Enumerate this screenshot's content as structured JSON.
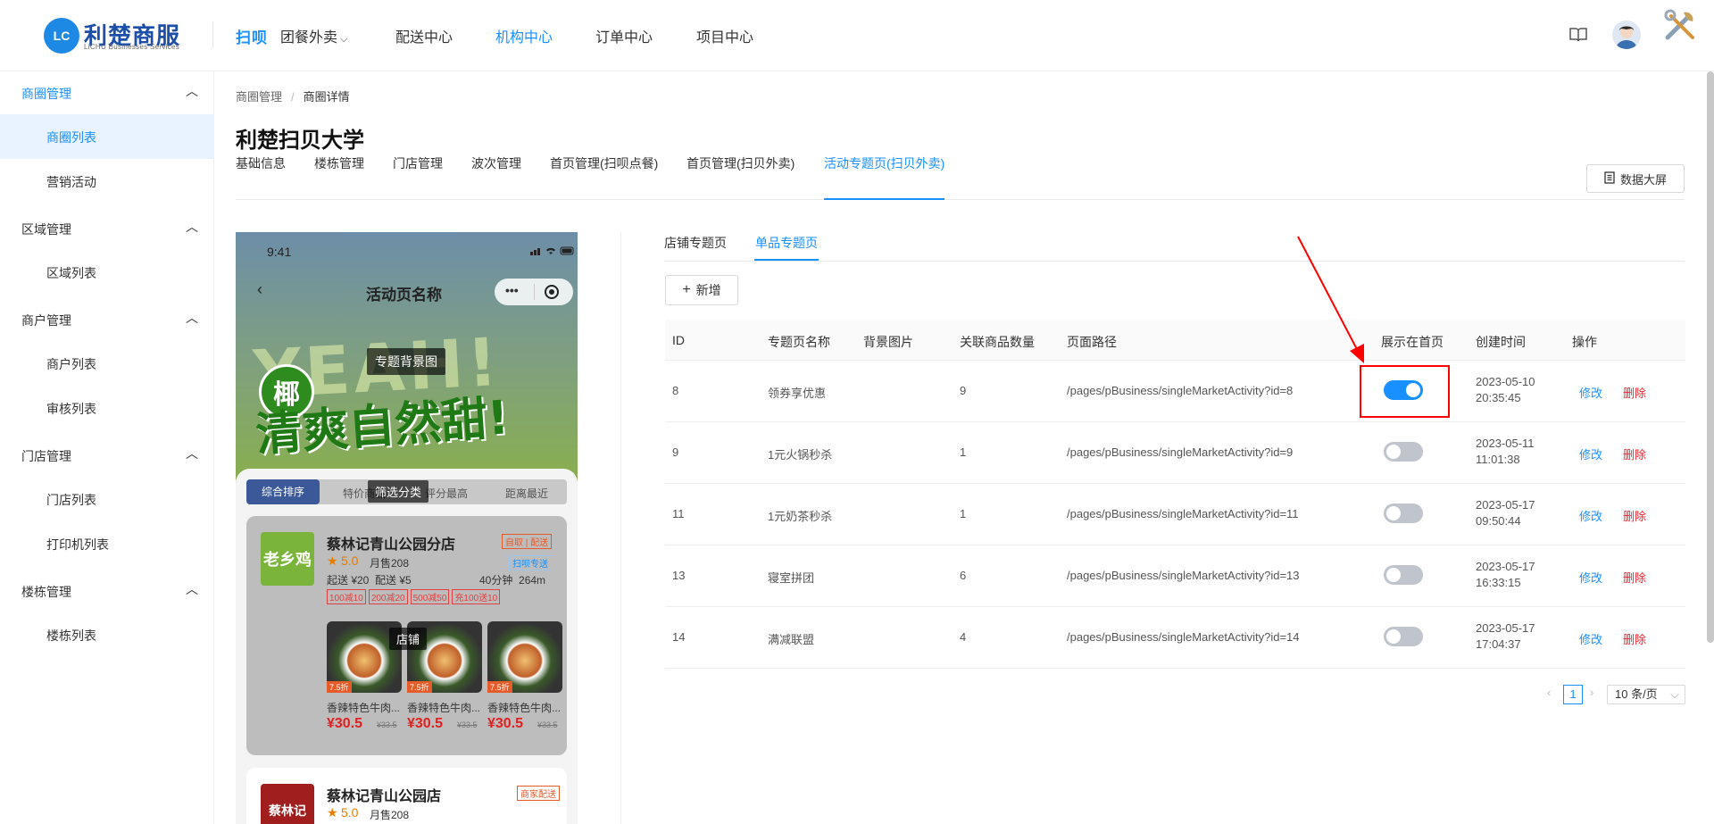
{
  "header": {
    "logo_badge": "LC",
    "logo_title": "利楚商服",
    "logo_subtitle": "LiCHU Businesses Services",
    "brand": "扫呗",
    "nav": [
      "团餐外卖",
      "配送中心",
      "机构中心",
      "订单中心",
      "项目中心"
    ],
    "active_nav": "机构中心",
    "icons": [
      "book-icon",
      "avatar",
      "tools-icon"
    ]
  },
  "sidebar": {
    "groups": [
      {
        "label": "商圈管理",
        "items": [
          "商圈列表",
          "营销活动"
        ]
      },
      {
        "label": "区域管理",
        "items": [
          "区域列表"
        ]
      },
      {
        "label": "商户管理",
        "items": [
          "商户列表",
          "审核列表"
        ]
      },
      {
        "label": "门店管理",
        "items": [
          "门店列表",
          "打印机列表"
        ]
      },
      {
        "label": "楼栋管理",
        "items": [
          "楼栋列表"
        ]
      }
    ],
    "active_item": "商圈列表"
  },
  "breadcrumb": [
    "商圈管理",
    "商圈详情"
  ],
  "page_title": "利楚扫贝大学",
  "tabs": [
    "基础信息",
    "楼栋管理",
    "门店管理",
    "波次管理",
    "首页管理(扫呗点餐)",
    "首页管理(扫贝外卖)",
    "活动专题页(扫贝外卖)"
  ],
  "active_tab": "活动专题页(扫贝外卖)",
  "data_screen_button": "数据大屏",
  "phone": {
    "time": "9:41",
    "title": "活动页名称",
    "bg_label": "专题背景图",
    "banner_text": "YEAH!",
    "slogan": "清爽自然甜!",
    "badge": "椰",
    "sort_tabs": [
      "综合排序",
      "特价商品",
      "评分最高",
      "距离最近"
    ],
    "filter_label": "筛选分类",
    "shop_label": "店铺",
    "store1": {
      "name": "蔡林记青山公园分店",
      "logo": "老乡鸡",
      "tags": "自取 | 配送",
      "rating": "5.0",
      "sales": "月售208",
      "fee": "起送 ¥20  配送 ¥5",
      "eta": "40分钟  264m",
      "express": "扫呗专送",
      "promos": [
        "100减10",
        "200减20",
        "500减50",
        "充100送10"
      ],
      "products": [
        {
          "name": "香辣特色牛肉...",
          "price": "¥30.5",
          "orig": "¥33.5",
          "discount": "7.5折"
        },
        {
          "name": "香辣特色牛肉...",
          "price": "¥30.5",
          "orig": "¥33.5",
          "discount": "7.5折"
        },
        {
          "name": "香辣特色牛肉...",
          "price": "¥30.5",
          "orig": "¥33.5",
          "discount": "7.5折"
        }
      ]
    },
    "store2": {
      "name": "蔡林记青山公园店",
      "logo": "蔡林记",
      "tags": "商家配送",
      "rating": "5.0",
      "sales": "月售208"
    }
  },
  "subtabs": [
    "店铺专题页",
    "单品专题页"
  ],
  "active_subtab": "单品专题页",
  "add_button": "新增",
  "table": {
    "columns": [
      "ID",
      "专题页名称",
      "背景图片",
      "关联商品数量",
      "页面路径",
      "展示在首页",
      "创建时间",
      "操作"
    ],
    "rows": [
      {
        "id": "8",
        "name": "领券享优惠",
        "count": "9",
        "path": "/pages/pBusiness/singleMarketActivity?id=8",
        "show": true,
        "date": "2023-05-10",
        "time": "20:35:45"
      },
      {
        "id": "9",
        "name": "1元火锅秒杀",
        "count": "1",
        "path": "/pages/pBusiness/singleMarketActivity?id=9",
        "show": false,
        "date": "2023-05-11",
        "time": "11:01:38"
      },
      {
        "id": "11",
        "name": "1元奶茶秒杀",
        "count": "1",
        "path": "/pages/pBusiness/singleMarketActivity?id=11",
        "show": false,
        "date": "2023-05-17",
        "time": "09:50:44"
      },
      {
        "id": "13",
        "name": "寝室拼团",
        "count": "6",
        "path": "/pages/pBusiness/singleMarketActivity?id=13",
        "show": false,
        "date": "2023-05-17",
        "time": "16:33:15"
      },
      {
        "id": "14",
        "name": "满减联盟",
        "count": "4",
        "path": "/pages/pBusiness/singleMarketActivity?id=14",
        "show": false,
        "date": "2023-05-17",
        "time": "17:04:37"
      }
    ],
    "edit_label": "修改",
    "delete_label": "删除"
  },
  "pagination": {
    "current": "1",
    "page_size": "10 条/页"
  },
  "colors": {
    "accent": "#1890ff",
    "danger": "#f5222d",
    "highlight": "#ff0000"
  }
}
